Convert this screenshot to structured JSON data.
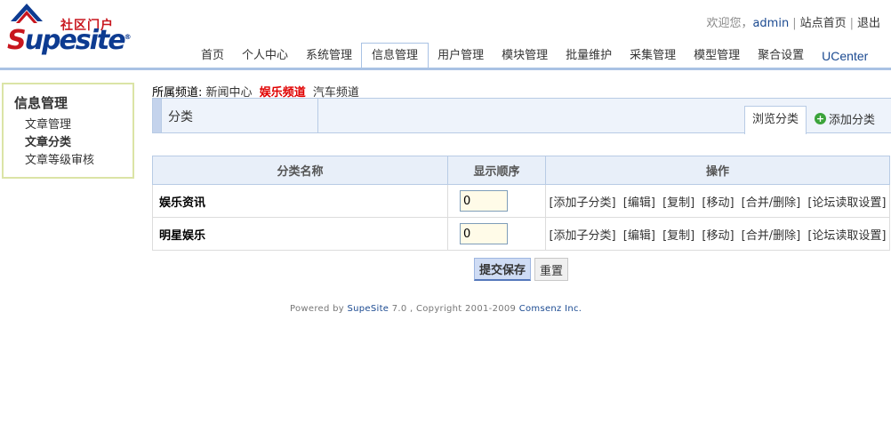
{
  "logo": {
    "cn": "社区门户",
    "word_s": "S",
    "word_rest": "upesite",
    "mark": "®"
  },
  "toplinks": {
    "welcome": "欢迎您，",
    "user": "admin",
    "home": "站点首页",
    "logout": "退出",
    "sep": "|"
  },
  "nav": {
    "tabs": [
      {
        "label": "首页"
      },
      {
        "label": "个人中心"
      },
      {
        "label": "系统管理"
      },
      {
        "label": "信息管理"
      },
      {
        "label": "用户管理"
      },
      {
        "label": "模块管理"
      },
      {
        "label": "批量维护"
      },
      {
        "label": "采集管理"
      },
      {
        "label": "模型管理"
      },
      {
        "label": "聚合设置"
      },
      {
        "label": "UCenter"
      }
    ],
    "active": "信息管理"
  },
  "sidebar": {
    "title": "信息管理",
    "items": [
      {
        "label": "文章管理"
      },
      {
        "label": "文章分类"
      },
      {
        "label": "文章等级审核"
      }
    ],
    "active": "文章分类"
  },
  "channel": {
    "prefix": "所属频道:",
    "items": [
      {
        "label": "新闻中心"
      },
      {
        "label": "娱乐频道"
      },
      {
        "label": "汽车频道"
      }
    ],
    "current": "娱乐频道"
  },
  "titlebar": {
    "title": "分类",
    "browse": "浏览分类",
    "add": "添加分类"
  },
  "table": {
    "headers": [
      "分类名称",
      "显示顺序",
      "操作"
    ],
    "rows": [
      {
        "name": "娱乐资讯",
        "order": "0"
      },
      {
        "name": "明星娱乐",
        "order": "0"
      }
    ],
    "ops": [
      "[添加子分类]",
      "[编辑]",
      "[复制]",
      "[移动]",
      "[合并/删除]",
      "[论坛读取设置]"
    ]
  },
  "buttons": {
    "submit": "提交保存",
    "reset": "重置"
  },
  "footer": {
    "pre": "Powered by ",
    "brand": "SupeSite",
    "mid": " 7.0 , Copyright 2001-2009 ",
    "company": "Comsenz Inc."
  },
  "colors": {
    "accent_blue": "#1b4a91",
    "logo_red": "#c8161e",
    "current_channel": "#e00000",
    "nav_border": "#a9c2e4"
  }
}
